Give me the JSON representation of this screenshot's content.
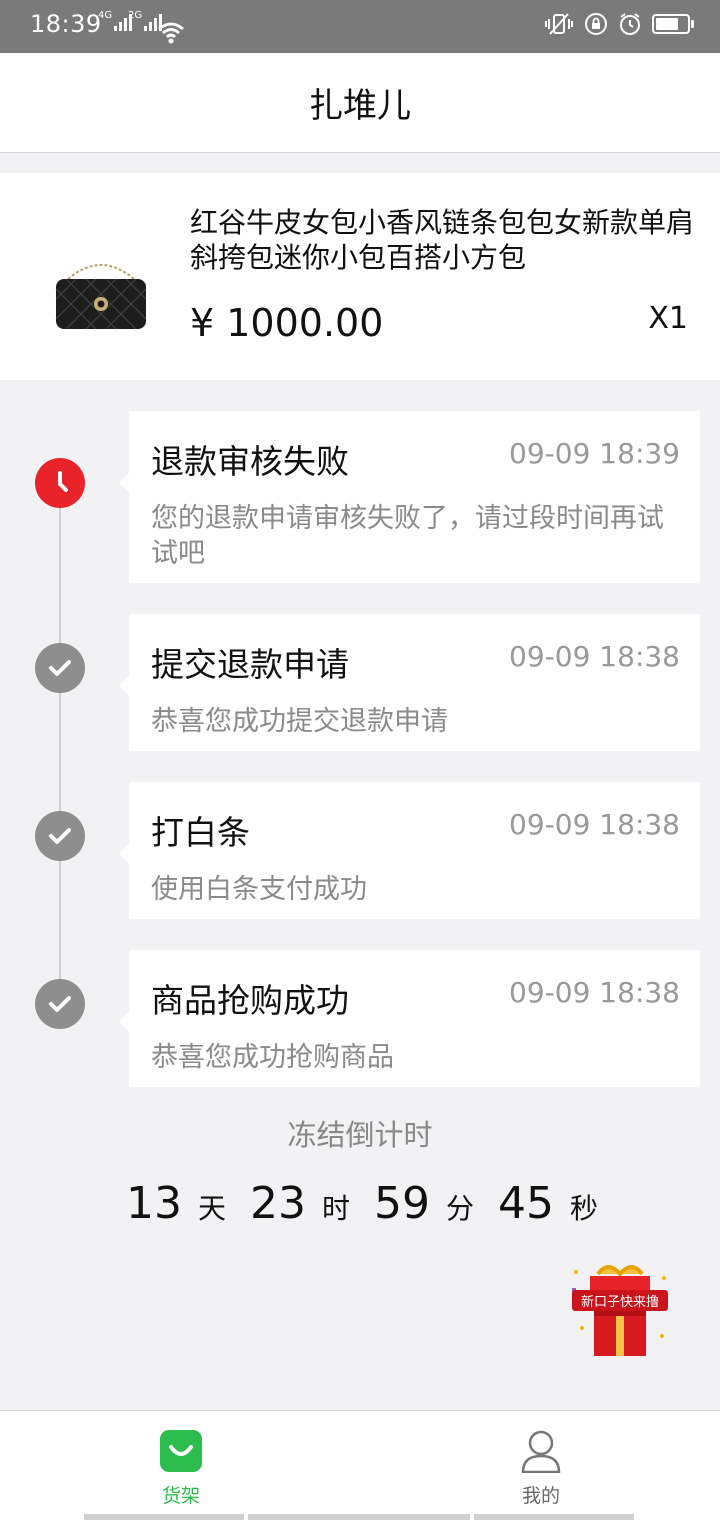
{
  "status_bar": {
    "time": "18:39",
    "sim1_label": "4G",
    "sim2_label": "2G"
  },
  "header": {
    "title": "扎堆儿"
  },
  "product": {
    "name": "红谷牛皮女包小香风链条包包女新款单肩斜挎包迷你小包百搭小方包",
    "price": "¥ 1000.00",
    "quantity": "X1"
  },
  "timeline": [
    {
      "title": "退款审核失败",
      "time": "09-09 18:39",
      "desc": "您的退款申请审核失败了，请过段时间再试试吧",
      "status": "failed",
      "icon": "clock-icon"
    },
    {
      "title": "提交退款申请",
      "time": "09-09 18:38",
      "desc": "恭喜您成功提交退款申请",
      "status": "done",
      "icon": "check-icon"
    },
    {
      "title": "打白条",
      "time": "09-09 18:38",
      "desc": "使用白条支付成功",
      "status": "done",
      "icon": "check-icon"
    },
    {
      "title": "商品抢购成功",
      "time": "09-09 18:38",
      "desc": "恭喜您成功抢购商品",
      "status": "done",
      "icon": "check-icon"
    }
  ],
  "countdown": {
    "label": "冻结倒计时",
    "days": "13",
    "days_unit": "天",
    "hours": "23",
    "hours_unit": "时",
    "minutes": "59",
    "minutes_unit": "分",
    "seconds": "45",
    "seconds_unit": "秒"
  },
  "promo": {
    "label": "新口子快来撸"
  },
  "bottom_nav": {
    "items": [
      {
        "label": "货架",
        "icon": "shopping-bag-icon",
        "active": true
      },
      {
        "label": "我的",
        "icon": "user-icon",
        "active": false
      }
    ]
  },
  "colors": {
    "accent_green": "#2dbd4e",
    "failed_red": "#e8232a",
    "done_gray": "#8e8e8e",
    "status_bar": "#7a7a7a",
    "background": "#f2f2f5"
  }
}
